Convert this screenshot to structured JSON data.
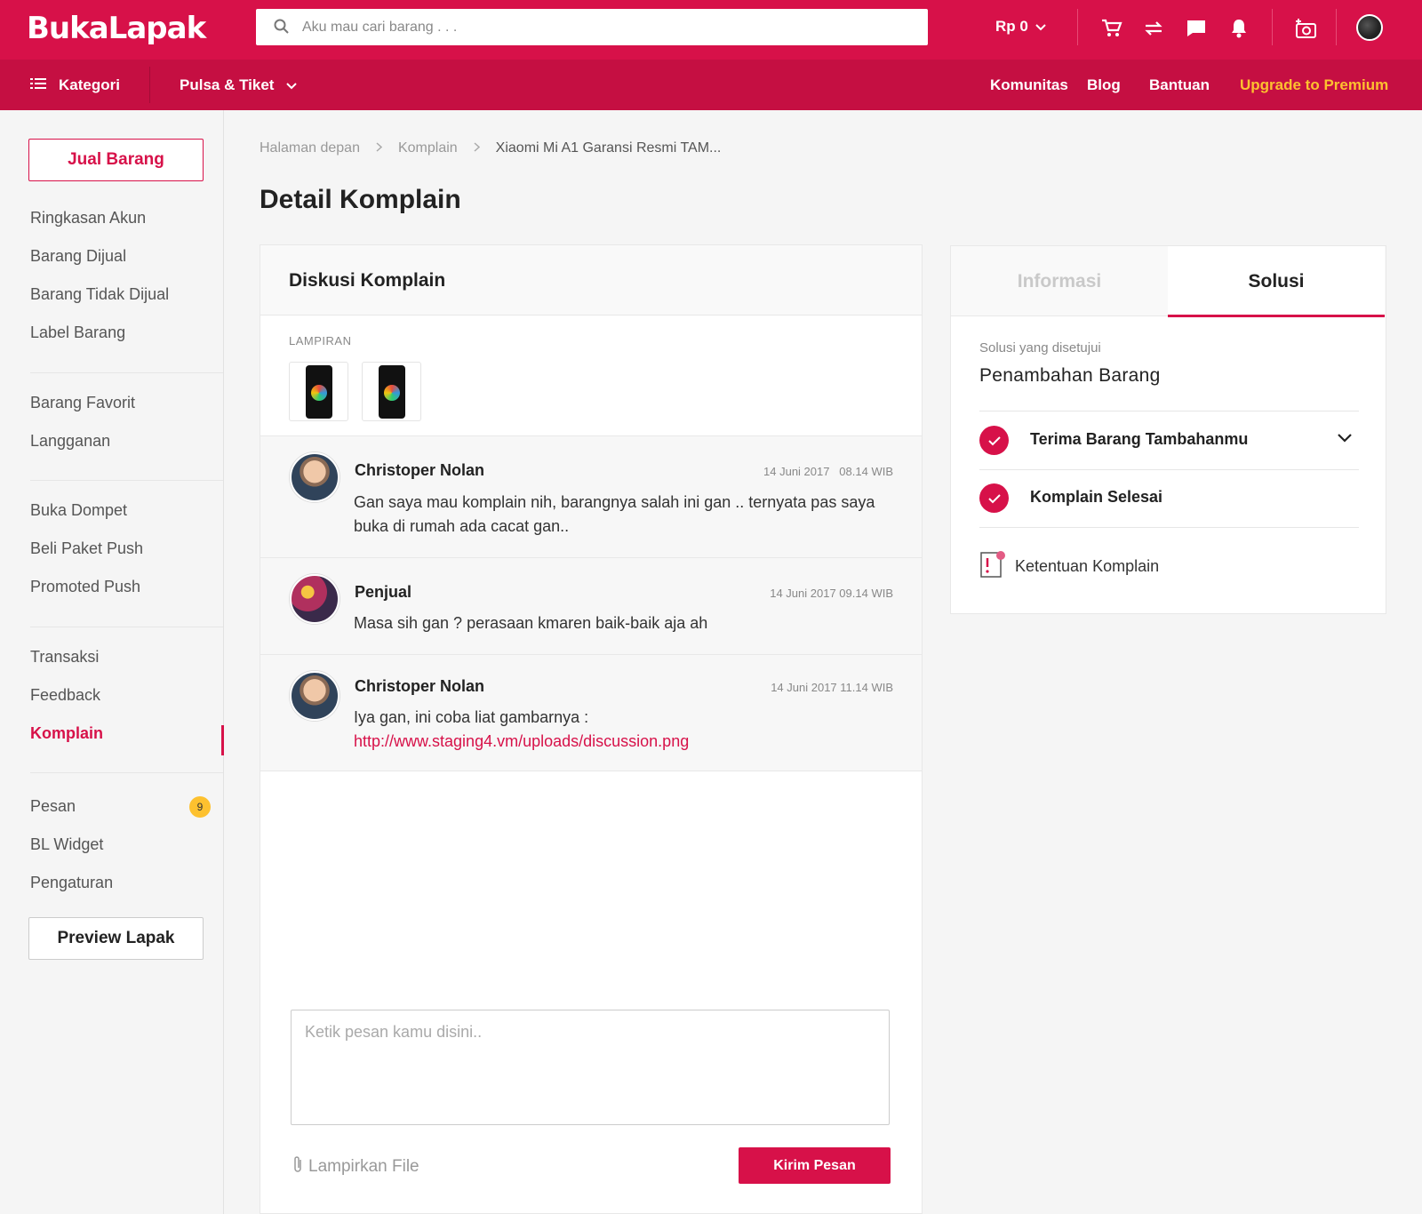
{
  "header": {
    "logo": "BukaLapak",
    "search_placeholder": "Aku mau cari barang . . .",
    "balance": "Rp 0",
    "icons": [
      "cart-icon",
      "transaction-icon",
      "chat-icon",
      "bell-icon",
      "camera-add-icon",
      "avatar"
    ]
  },
  "nav": {
    "kategori": "Kategori",
    "pulsa": "Pulsa & Tiket",
    "komunitas": "Komunitas",
    "blog": "Blog",
    "bantuan": "Bantuan",
    "premium": "Upgrade to Premium"
  },
  "sidebar": {
    "sell_button": "Jual Barang",
    "items": [
      "Ringkasan Akun",
      "Barang Dijual",
      "Barang Tidak Dijual",
      "Label Barang",
      "Barang Favorit",
      "Langganan",
      "Buka Dompet",
      "Beli Paket Push",
      "Promoted Push",
      "Transaksi",
      "Feedback",
      "Komplain",
      "Pesan",
      "BL Widget",
      "Pengaturan"
    ],
    "active_item": "Komplain",
    "pesan_badge": "9",
    "preview_button": "Preview Lapak"
  },
  "breadcrumb": [
    "Halaman depan",
    "Komplain",
    "Xiaomi Mi A1 Garansi Resmi TAM..."
  ],
  "page_title": "Detail Komplain",
  "discussion": {
    "title": "Diskusi Komplain",
    "attachments_label": "LAMPIRAN",
    "messages": [
      {
        "name": "Christoper Nolan",
        "time": "14 Juni 2017   08.14 WIB",
        "text": "Gan saya mau komplain nih, barangnya salah ini gan .. ternyata pas saya buka di rumah ada cacat gan.."
      },
      {
        "name": "Penjual",
        "time": "14 Juni 2017 09.14 WIB",
        "text": "Masa sih gan ?  perasaan kmaren baik-baik aja ah"
      },
      {
        "name": "Christoper Nolan",
        "time": "14 Juni 2017 11.14 WIB",
        "text": "Iya gan, ini coba liat gambarnya :",
        "link": "http://www.staging4.vm/uploads/discussion.png"
      }
    ],
    "compose_placeholder": "Ketik pesan kamu disini..",
    "attach_label": "Lampirkan File",
    "send_button": "Kirim Pesan"
  },
  "info_panel": {
    "tabs": [
      "Informasi",
      "Solusi"
    ],
    "active_tab": "Solusi",
    "solution_label": "Solusi yang disetujui",
    "solution_value": "Penambahan Barang",
    "steps": [
      "Terima Barang Tambahanmu",
      "Komplain Selesai"
    ],
    "rules_link": "Ketentuan Komplain"
  },
  "colors": {
    "brand": "#d71149",
    "nav": "#c50f42",
    "premium": "#fdc12f"
  }
}
